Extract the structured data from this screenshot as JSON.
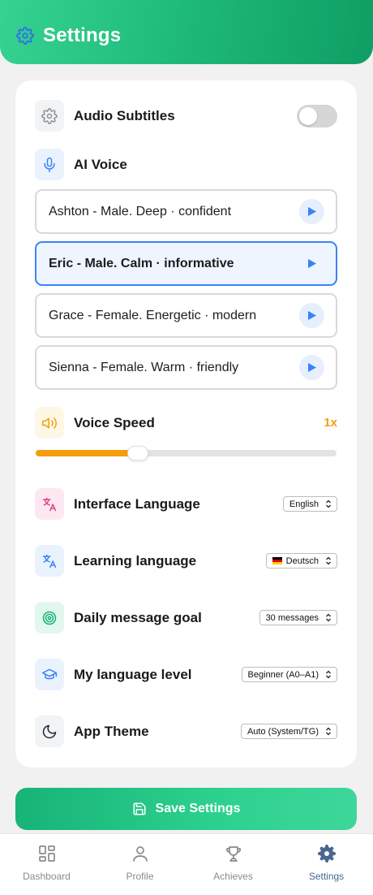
{
  "header": {
    "title": "Settings",
    "icon": "gear-icon"
  },
  "audio_subtitles": {
    "label": "Audio Subtitles",
    "enabled": false
  },
  "ai_voice": {
    "label": "AI Voice",
    "options": [
      {
        "name": "Ashton - Male. Deep · confident",
        "selected": false
      },
      {
        "name": "Eric - Male. Calm · informative",
        "selected": true
      },
      {
        "name": "Grace - Female. Energetic · modern",
        "selected": false
      },
      {
        "name": "Sienna - Female. Warm · friendly",
        "selected": false
      }
    ]
  },
  "voice_speed": {
    "label": "Voice Speed",
    "value_label": "1x",
    "slider_fraction": 0.34
  },
  "interface_language": {
    "label": "Interface Language",
    "value": "English"
  },
  "learning_language": {
    "label": "Learning language",
    "value": "Deutsch",
    "flag": "german-flag"
  },
  "daily_goal": {
    "label": "Daily message goal",
    "value": "30 messages"
  },
  "language_level": {
    "label": "My language level",
    "value": "Beginner (A0–A1)"
  },
  "app_theme": {
    "label": "App Theme",
    "value": "Auto (System/TG)"
  },
  "save_button": {
    "label": "Save Settings"
  },
  "nav": {
    "items": [
      {
        "label": "Dashboard",
        "icon": "dashboard-icon",
        "active": false
      },
      {
        "label": "Profile",
        "icon": "user-icon",
        "active": false
      },
      {
        "label": "Achieves",
        "icon": "trophy-icon",
        "active": false
      },
      {
        "label": "Settings",
        "icon": "gear-icon",
        "active": true
      }
    ]
  },
  "colors": {
    "brand_green": "#1fbc7c",
    "accent_blue": "#3b82f6",
    "speed_orange": "#f59e0b",
    "nav_active": "#4a6790"
  }
}
